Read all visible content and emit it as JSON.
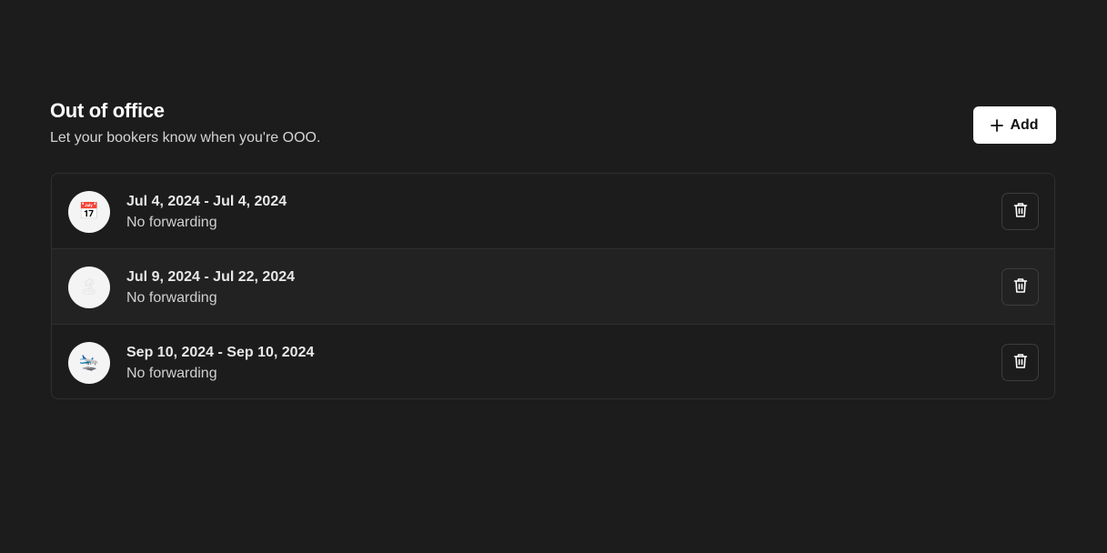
{
  "header": {
    "title": "Out of office",
    "subtitle": "Let your bookers know when you're OOO.",
    "add_label": "Add"
  },
  "entries": [
    {
      "icon": "calendar-emoji",
      "emoji": "📅",
      "date_range": "Jul 4, 2024 - Jul 4, 2024",
      "forwarding": "No forwarding"
    },
    {
      "icon": "island-emoji",
      "emoji": "🏝",
      "date_range": "Jul 9, 2024 - Jul 22, 2024",
      "forwarding": "No forwarding"
    },
    {
      "icon": "airplane-emoji",
      "emoji": "🛬",
      "date_range": "Sep 10, 2024 - Sep 10, 2024",
      "forwarding": "No forwarding"
    }
  ],
  "colors": {
    "background": "#1c1c1c",
    "border": "#2f2f2f",
    "button_bg": "#ffffff"
  }
}
